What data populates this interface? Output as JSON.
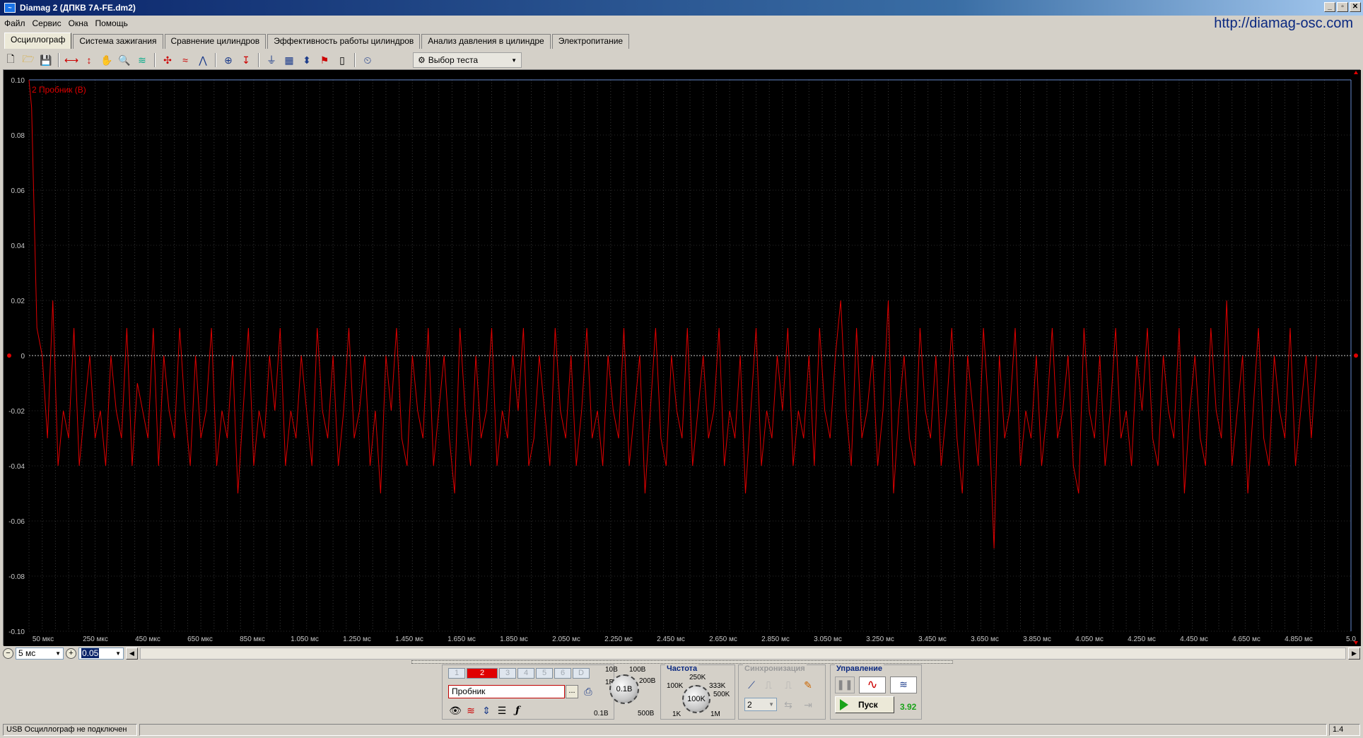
{
  "window": {
    "title": "Diamag 2 (ДПКВ 7А-FE.dm2)",
    "url": "http://diamag-osc.com",
    "buttons": [
      "_",
      "▫",
      "✕"
    ]
  },
  "menu": [
    "Файл",
    "Сервис",
    "Окна",
    "Помощь"
  ],
  "tabs": [
    {
      "label": "Осциллограф",
      "active": true
    },
    {
      "label": "Система зажигания",
      "active": false
    },
    {
      "label": "Сравнение цилиндров",
      "active": false
    },
    {
      "label": "Эффективность работы цилиндров",
      "active": false
    },
    {
      "label": "Анализ давления в цилиндре",
      "active": false
    },
    {
      "label": "Электропитание",
      "active": false
    }
  ],
  "toolbar": {
    "test_select_label": "Выбор теста"
  },
  "scope": {
    "channel_label": "2  Пробник (В)",
    "y_ticks": [
      "0.10",
      "0.08",
      "0.06",
      "0.04",
      "0.02",
      "0",
      "-0.02",
      "-0.04",
      "-0.06",
      "-0.08",
      "-0.10"
    ],
    "x_ticks": [
      "50 мкс",
      "250 мкс",
      "450 мкс",
      "650 мкс",
      "850 мкс",
      "1.050 мс",
      "1.250 мс",
      "1.450 мс",
      "1.650 мс",
      "1.850 мс",
      "2.050 мс",
      "2.250 мс",
      "2.450 мс",
      "2.650 мс",
      "2.850 мс",
      "3.050 мс",
      "3.250 мс",
      "3.450 мс",
      "3.650 мс",
      "3.850 мс",
      "4.050 мс",
      "4.250 мс",
      "4.450 мс",
      "4.650 мс",
      "4.850 мс",
      "5.0"
    ],
    "trace_color": "#e00000",
    "background": "#000000"
  },
  "chart_data": {
    "type": "line",
    "title": "2  Пробник (В)",
    "xlabel": "",
    "ylabel": "",
    "ylim": [
      -0.1,
      0.1
    ],
    "xlim_ms": [
      0.0,
      5.0
    ],
    "grid": true,
    "series": [
      {
        "name": "2  Пробник (В)",
        "x_ms": [
          0.0,
          0.01,
          0.03,
          0.05,
          0.07,
          0.09,
          0.11,
          0.13,
          0.15,
          0.17,
          0.19,
          0.21,
          0.23,
          0.25,
          0.27,
          0.29,
          0.31,
          0.33,
          0.35,
          0.37,
          0.39,
          0.41,
          0.43,
          0.45,
          0.47,
          0.49,
          0.51,
          0.53,
          0.55,
          0.57,
          0.59,
          0.61,
          0.63,
          0.65,
          0.67,
          0.69,
          0.71,
          0.73,
          0.75,
          0.77,
          0.79,
          0.81,
          0.83,
          0.85,
          0.87,
          0.89,
          0.91,
          0.93,
          0.95,
          0.97,
          0.99,
          1.01,
          1.03,
          1.05,
          1.07,
          1.09,
          1.11,
          1.13,
          1.15,
          1.17,
          1.19,
          1.21,
          1.23,
          1.25,
          1.27,
          1.29,
          1.31,
          1.33,
          1.35,
          1.37,
          1.39,
          1.41,
          1.43,
          1.45,
          1.47,
          1.49,
          1.51,
          1.53,
          1.55,
          1.57,
          1.59,
          1.61,
          1.63,
          1.65,
          1.67,
          1.69,
          1.71,
          1.73,
          1.75,
          1.77,
          1.79,
          1.81,
          1.83,
          1.85,
          1.87,
          1.89,
          1.91,
          1.93,
          1.95,
          1.97,
          1.99,
          2.01,
          2.03,
          2.05,
          2.07,
          2.09,
          2.11,
          2.13,
          2.15,
          2.17,
          2.19,
          2.21,
          2.23,
          2.25,
          2.27,
          2.29,
          2.31,
          2.33,
          2.35,
          2.37,
          2.39,
          2.41,
          2.43,
          2.45,
          2.47,
          2.49,
          2.51,
          2.53,
          2.55,
          2.57,
          2.59,
          2.61,
          2.63,
          2.65,
          2.67,
          2.69,
          2.71,
          2.73,
          2.75,
          2.77,
          2.79,
          2.81,
          2.83,
          2.85,
          2.87,
          2.89,
          2.91,
          2.93,
          2.95,
          2.97,
          2.99,
          3.01,
          3.03,
          3.05,
          3.07,
          3.09,
          3.11,
          3.13,
          3.15,
          3.17,
          3.19,
          3.21,
          3.23,
          3.25,
          3.27,
          3.29,
          3.31,
          3.33,
          3.35,
          3.37,
          3.39,
          3.41,
          3.43,
          3.45,
          3.47,
          3.49,
          3.51,
          3.53,
          3.55,
          3.57,
          3.59,
          3.61,
          3.63,
          3.65,
          3.67,
          3.69,
          3.71,
          3.73,
          3.75,
          3.77,
          3.79,
          3.81,
          3.83,
          3.85,
          3.87,
          3.89,
          3.91,
          3.93,
          3.95,
          3.97,
          3.99,
          4.01,
          4.03,
          4.05,
          4.07,
          4.09,
          4.11,
          4.13,
          4.15,
          4.17,
          4.19,
          4.21,
          4.23,
          4.25,
          4.27,
          4.29,
          4.31,
          4.33,
          4.35,
          4.37,
          4.39,
          4.41,
          4.43,
          4.45,
          4.47,
          4.49,
          4.51,
          4.53,
          4.55,
          4.57,
          4.59,
          4.61,
          4.63,
          4.65,
          4.67,
          4.69,
          4.71,
          4.73,
          4.75,
          4.77,
          4.79,
          4.81,
          4.83,
          4.85,
          4.87,
          4.89,
          4.91,
          4.93,
          4.95,
          4.97,
          4.99
        ],
        "y": [
          0.1,
          0.09,
          0.01,
          0.0,
          -0.03,
          0.02,
          -0.04,
          -0.02,
          -0.03,
          0.01,
          -0.04,
          -0.02,
          0.0,
          -0.03,
          -0.02,
          -0.04,
          0.0,
          -0.02,
          -0.03,
          0.01,
          -0.04,
          -0.01,
          -0.02,
          -0.03,
          0.01,
          -0.04,
          0.0,
          -0.02,
          -0.03,
          0.01,
          -0.02,
          -0.04,
          0.0,
          -0.03,
          -0.02,
          0.01,
          -0.04,
          -0.02,
          -0.03,
          0.0,
          -0.05,
          -0.02,
          0.01,
          -0.04,
          -0.02,
          -0.03,
          0.0,
          -0.02,
          0.01,
          -0.04,
          -0.02,
          -0.03,
          0.0,
          -0.02,
          -0.04,
          0.01,
          -0.02,
          -0.03,
          0.0,
          -0.04,
          -0.02,
          0.01,
          -0.03,
          -0.02,
          0.0,
          -0.04,
          -0.02,
          -0.05,
          0.0,
          -0.02,
          0.01,
          -0.03,
          -0.04,
          0.0,
          -0.02,
          -0.03,
          0.01,
          -0.04,
          -0.02,
          0.0,
          -0.03,
          -0.05,
          0.01,
          -0.02,
          -0.04,
          0.0,
          -0.03,
          -0.02,
          0.01,
          -0.04,
          -0.02,
          -0.03,
          0.0,
          -0.02,
          0.01,
          -0.04,
          -0.03,
          0.0,
          -0.02,
          -0.04,
          0.01,
          -0.02,
          -0.03,
          0.0,
          -0.04,
          -0.02,
          0.01,
          -0.03,
          -0.02,
          -0.04,
          0.0,
          -0.02,
          -0.03,
          0.01,
          -0.04,
          -0.02,
          0.0,
          -0.05,
          -0.02,
          0.01,
          -0.03,
          -0.04,
          0.0,
          -0.02,
          -0.03,
          0.01,
          -0.04,
          -0.02,
          0.0,
          -0.03,
          -0.02,
          0.01,
          -0.04,
          -0.02,
          -0.03,
          0.0,
          -0.05,
          -0.02,
          0.01,
          -0.04,
          -0.02,
          -0.03,
          0.0,
          -0.02,
          0.01,
          -0.04,
          -0.02,
          -0.03,
          0.0,
          -0.04,
          0.01,
          -0.02,
          -0.03,
          0.0,
          0.02,
          -0.02,
          -0.04,
          0.01,
          -0.03,
          -0.02,
          0.0,
          -0.04,
          -0.02,
          0.02,
          -0.05,
          -0.02,
          0.0,
          -0.03,
          -0.04,
          0.01,
          -0.02,
          -0.03,
          0.0,
          -0.04,
          -0.02,
          0.01,
          -0.03,
          -0.05,
          0.0,
          -0.02,
          -0.04,
          0.01,
          -0.02,
          -0.07,
          0.0,
          -0.03,
          -0.02,
          0.01,
          -0.04,
          -0.02,
          -0.03,
          0.0,
          -0.04,
          -0.02,
          0.01,
          -0.03,
          -0.02,
          0.0,
          -0.04,
          -0.05,
          0.01,
          -0.02,
          -0.03,
          0.0,
          -0.04,
          -0.02,
          0.01,
          -0.03,
          -0.02,
          -0.04,
          0.0,
          -0.02,
          0.01,
          -0.03,
          -0.04,
          0.0,
          -0.02,
          -0.03,
          0.01,
          -0.05,
          -0.02,
          0.0,
          -0.03,
          -0.04,
          0.01,
          -0.02,
          -0.03,
          0.02,
          -0.04,
          -0.02,
          0.0,
          -0.05,
          -0.02,
          0.01,
          -0.03,
          -0.04,
          0.0,
          -0.02,
          -0.03,
          0.01,
          -0.04,
          -0.02,
          0.0,
          -0.03,
          0.0
        ]
      }
    ]
  },
  "timebase": {
    "value": "5 мс",
    "offset": "0.05"
  },
  "channels": {
    "buttons": [
      "1",
      "2",
      "3",
      "4",
      "5",
      "6",
      "D"
    ],
    "active": "2",
    "probe_name": "Пробник",
    "dots": "...",
    "knob_value": "0.1В",
    "knob_labels": [
      "1В",
      "10В",
      "100В",
      "200В",
      "500В",
      "0.1В"
    ]
  },
  "frequency": {
    "title": "Частота",
    "knob_value": "100K",
    "knob_labels": [
      "250K",
      "100K",
      "333K",
      "500K",
      "1K",
      "1M"
    ]
  },
  "sync": {
    "title": "Синхронизация",
    "channel_value": "2"
  },
  "control": {
    "title": "Управление",
    "start_label": "Пуск",
    "value": "3.92",
    "value_color": "#1aa31a"
  },
  "status": {
    "left": "USB Осциллограф не подключен",
    "right": "1.4"
  }
}
